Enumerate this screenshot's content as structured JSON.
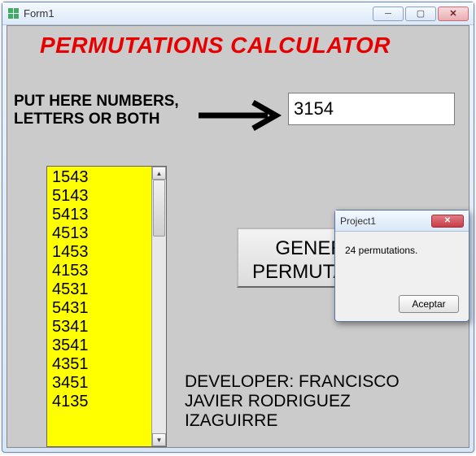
{
  "window": {
    "title": "Form1"
  },
  "heading": "PERMUTATIONS CALCULATOR",
  "instruction_line1": "PUT HERE NUMBERS,",
  "instruction_line2": "LETTERS OR BOTH",
  "input_value": "3154",
  "results": [
    "1543",
    "5143",
    "5413",
    "4513",
    "1453",
    "4153",
    "4531",
    "5431",
    "5341",
    "3541",
    "4351",
    "3451",
    "4135"
  ],
  "generate_line1": "GENERATE",
  "generate_line2": "PERMUTATIONS",
  "developer_line1": "DEVELOPER: FRANCISCO",
  "developer_line2": "JAVIER RODRIGUEZ",
  "developer_line3": "IZAGUIRRE",
  "dialog": {
    "title": "Project1",
    "message": "24 permutations.",
    "ok_label": "Aceptar"
  }
}
